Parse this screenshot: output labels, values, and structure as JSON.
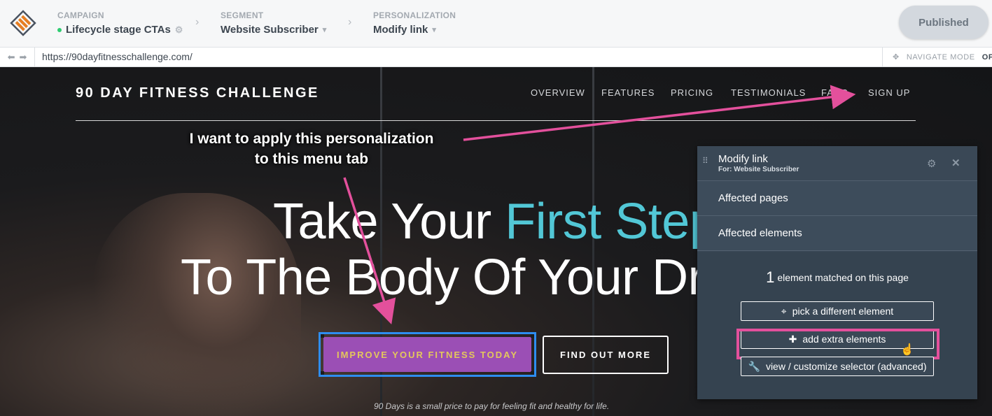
{
  "app": {
    "breadcrumbs": [
      {
        "label": "CAMPAIGN",
        "value": "Lifecycle stage CTAs"
      },
      {
        "label": "SEGMENT",
        "value": "Website Subscriber"
      },
      {
        "label": "PERSONALIZATION",
        "value": "Modify link"
      }
    ],
    "published_label": "Published"
  },
  "urlbar": {
    "url": "https://90dayfitnesschallenge.com/",
    "navigate_mode_label": "NAVIGATE MODE",
    "navigate_mode_state": "OF"
  },
  "site": {
    "brand": "90 DAY FITNESS CHALLENGE",
    "nav": [
      "OVERVIEW",
      "FEATURES",
      "PRICING",
      "TESTIMONIALS",
      "FAQS",
      "SIGN UP"
    ],
    "hero_line1_a": "Take Your ",
    "hero_line1_b": "First Step",
    "hero_line2": "To The Body Of Your Dre",
    "cta_primary": "IMPROVE YOUR FITNESS TODAY",
    "cta_secondary": "FIND OUT MORE",
    "tagline": "90 Days is a small price to pay for feeling fit and healthy for life.",
    "accent_color": "#52c7d6",
    "cta_color": "#9b4fb5"
  },
  "annotation": {
    "line1": "I want to apply this personalization",
    "line2": "to this menu tab",
    "color": "#e3509c"
  },
  "panel": {
    "title": "Modify link",
    "subtitle": "For: Website Subscriber",
    "rows": [
      "Affected pages",
      "Affected elements"
    ],
    "match_count": "1",
    "match_text": "element matched on this page",
    "buttons": {
      "pick": "pick a different element",
      "add": "add extra elements",
      "view": "view / customize selector (advanced)"
    }
  }
}
